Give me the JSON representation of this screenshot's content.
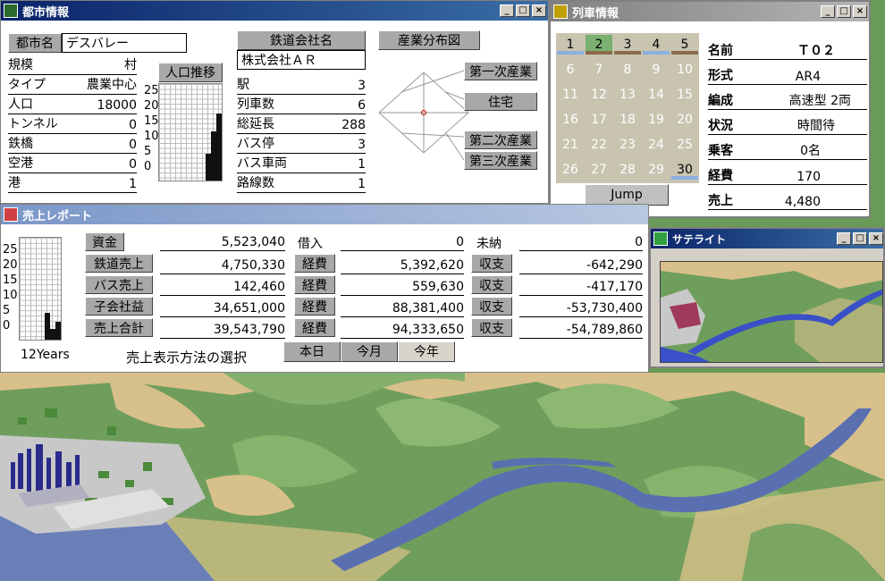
{
  "city": {
    "title": "都市情報",
    "name_label": "都市名",
    "name": "デスバレー",
    "rows": [
      {
        "label": "規模",
        "value": "村"
      },
      {
        "label": "タイプ",
        "value": "農業中心"
      },
      {
        "label": "人口",
        "value": "18000"
      },
      {
        "label": "トンネル",
        "value": "0"
      },
      {
        "label": "鉄橋",
        "value": "0"
      },
      {
        "label": "空港",
        "value": "0"
      },
      {
        "label": "港",
        "value": "1"
      }
    ],
    "pop_trend_label": "人口推移",
    "axis_ticks": [
      "25",
      "20",
      "15",
      "10",
      "5",
      "0"
    ],
    "company_label": "鉄道会社名",
    "company": "株式会社ＡＲ",
    "stats": [
      {
        "label": "駅",
        "value": "3"
      },
      {
        "label": "列車数",
        "value": "6"
      },
      {
        "label": "総延長",
        "value": "288"
      },
      {
        "label": "バス停",
        "value": "3"
      },
      {
        "label": "バス車両",
        "value": "1"
      },
      {
        "label": "路線数",
        "value": "1"
      }
    ],
    "industry_button": "産業分布図",
    "industries": [
      "第一次産業",
      "住宅",
      "第二次産業",
      "第三次産業"
    ]
  },
  "train": {
    "title": "列車情報",
    "slots": [
      "1",
      "2",
      "3",
      "4",
      "5",
      "6",
      "7",
      "8",
      "9",
      "10",
      "11",
      "12",
      "13",
      "14",
      "15",
      "16",
      "17",
      "18",
      "19",
      "20",
      "21",
      "22",
      "23",
      "24",
      "25",
      "26",
      "27",
      "28",
      "29",
      "30"
    ],
    "jump": "Jump",
    "fields": [
      {
        "label": "名前",
        "value": "Ｔ０２"
      },
      {
        "label": "形式",
        "value": "AR4"
      },
      {
        "label": "編成",
        "value": "高速型 2両"
      },
      {
        "label": "状況",
        "value": "時間待"
      },
      {
        "label": "乗客",
        "value": "0名"
      },
      {
        "label": "経費",
        "value": "170"
      },
      {
        "label": "売上",
        "value": "4,480"
      }
    ]
  },
  "sales": {
    "title": "売上レポート",
    "axis_ticks": [
      "25",
      "20",
      "15",
      "10",
      "5",
      "0"
    ],
    "years_label": "12Years",
    "rows": [
      {
        "label": "資金",
        "value": "5,523,040",
        "mid_label": "借入",
        "mid_value": "0",
        "right_label": "未納",
        "right_value": "0"
      },
      {
        "label": "鉄道売上",
        "value": "4,750,330",
        "mid_label": "経費",
        "mid_value": "5,392,620",
        "right_label": "収支",
        "right_value": "-642,290"
      },
      {
        "label": "バス売上",
        "value": "142,460",
        "mid_label": "経費",
        "mid_value": "559,630",
        "right_label": "収支",
        "right_value": "-417,170"
      },
      {
        "label": "子会社益",
        "value": "34,651,000",
        "mid_label": "経費",
        "mid_value": "88,381,400",
        "right_label": "収支",
        "right_value": "-53,730,400"
      },
      {
        "label": "売上合計",
        "value": "39,543,790",
        "mid_label": "経費",
        "mid_value": "94,333,650",
        "right_label": "収支",
        "right_value": "-54,789,860"
      }
    ],
    "method_label": "売上表示方法の選択",
    "tabs": [
      "本日",
      "今月",
      "今年"
    ]
  },
  "satellite": {
    "title": "サテライト"
  },
  "colors": {
    "title_active": "#0a246a",
    "title_inactive": "#808080",
    "grass": "#6a9a58",
    "river": "#5a6fb0",
    "sand": "#d8c08a"
  }
}
